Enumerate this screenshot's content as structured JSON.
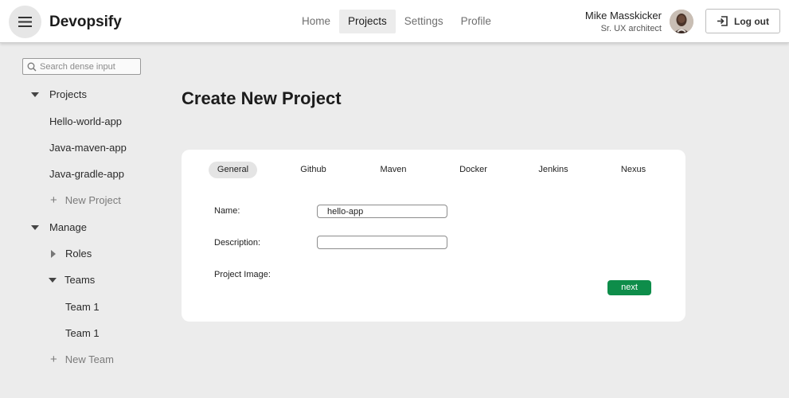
{
  "app": {
    "brand": "Devopsify"
  },
  "header": {
    "nav": [
      {
        "label": "Home",
        "active": false
      },
      {
        "label": "Projects",
        "active": true
      },
      {
        "label": "Settings",
        "active": false
      },
      {
        "label": "Profile",
        "active": false
      }
    ],
    "user": {
      "name": "Mike Masskicker",
      "role": "Sr. UX architect"
    },
    "logout_label": "Log out"
  },
  "sidebar": {
    "search": {
      "placeholder": "Search dense input",
      "value": ""
    },
    "projects_label": "Projects",
    "projects": [
      "Hello-world-app",
      "Java-maven-app",
      "Java-gradle-app"
    ],
    "new_project_label": "New Project",
    "manage_label": "Manage",
    "roles_label": "Roles",
    "teams_label": "Teams",
    "teams": [
      "Team 1",
      "Team 1"
    ],
    "new_team_label": "New Team"
  },
  "main": {
    "title": "Create New Project",
    "tabs": [
      {
        "label": "General",
        "active": true
      },
      {
        "label": "Github",
        "active": false
      },
      {
        "label": "Maven",
        "active": false
      },
      {
        "label": "Docker",
        "active": false
      },
      {
        "label": "Jenkins",
        "active": false
      },
      {
        "label": "Nexus",
        "active": false
      }
    ],
    "form": {
      "name_label": "Name:",
      "name_value": "hello-app",
      "description_label": "Description:",
      "description_value": "",
      "image_label": "Project Image:"
    },
    "next_label": "next"
  },
  "colors": {
    "accent": "#0e8d4a",
    "background": "#ececec"
  },
  "icons": [
    "hamburger-icon",
    "logout-icon",
    "search-icon",
    "caret-down-icon",
    "caret-right-icon",
    "plus-icon"
  ]
}
